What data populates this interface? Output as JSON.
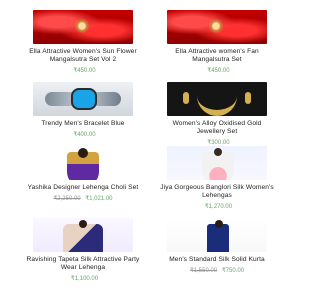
{
  "products": [
    {
      "id": "p1",
      "title": "Ella Attractive Women's Sun Flower Mangalsutra Set Vol 2",
      "price_old": "",
      "price_new": "₹450.00"
    },
    {
      "id": "p2",
      "title": "Ella Attractive women's Fan Mangalsutra Set",
      "price_old": "",
      "price_new": "₹450.00"
    },
    {
      "id": "p3",
      "title": "Trendy Men's Bracelet Blue",
      "price_old": "",
      "price_new": "₹400.00"
    },
    {
      "id": "p4",
      "title": "Women's Alloy Oxidised Gold Jewellery Set",
      "price_old": "",
      "price_new": "₹300.00"
    },
    {
      "id": "p5",
      "title": "Yashika Designer Lehenga Choli Set",
      "price_old": "₹2,250.00",
      "price_new": "₹1,021.00"
    },
    {
      "id": "p6",
      "title": "Jiya Gorgeous Banglori Silk Women's Lehengas",
      "price_old": "",
      "price_new": "₹1,270.00"
    },
    {
      "id": "p7",
      "title": "Ravishing Tapeta Silk Attractive Party Wear Lehenga",
      "price_old": "",
      "price_new": "₹1,100.00"
    },
    {
      "id": "p8",
      "title": "Men's Standard Silk Solid Kurta",
      "price_old": "₹1,550.00",
      "price_new": "₹750.00"
    }
  ]
}
